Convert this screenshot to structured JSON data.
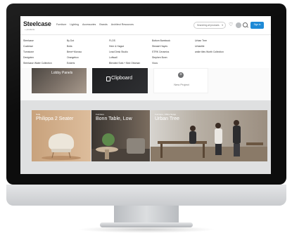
{
  "brand": {
    "name": "Steelcase",
    "sub": "+ products"
  },
  "nav": [
    "Furniture",
    "Lighting",
    "Accessories",
    "Brands",
    "Architect Resources"
  ],
  "search": {
    "placeholder": "Searching all products"
  },
  "sign_in": {
    "label": "Sign in"
  },
  "dropdown": {
    "col1": [
      "Steelcase",
      "Coalesse",
      "Turnstone",
      "Designtex",
      "Steelcase Water Collection"
    ],
    "col2": [
      "By Dot",
      "Bolia",
      "Bene+Moroso",
      "Orangebox",
      "Eckerts"
    ],
    "col3": [
      "FLOS",
      "Hem & Hague",
      "Lead Desk Studio",
      "Loftwall",
      "Blended Sofa + Bed Ottoman"
    ],
    "col4": [
      "Bottom Bambook",
      "Stewart Hayes",
      "STRK Ceramics",
      "Stephen Bunn",
      "Viccs"
    ],
    "col5": [
      "Urban Tree",
      "Urbantile",
      "ankle tiles Worth Collection"
    ]
  },
  "cards": {
    "card1": "Lobby Panels",
    "card2": "Clipboard",
    "card3": "New Project"
  },
  "tiles": [
    {
      "tag": "Sofa",
      "title": "Philippa 2 Seater"
    },
    {
      "tag": "Furniture",
      "title": "Bonn Table, Low"
    },
    {
      "tag": "Furniture, Office Setup",
      "title": "Urban Tree"
    }
  ],
  "colors": {
    "accent": "#1e8ad6"
  }
}
